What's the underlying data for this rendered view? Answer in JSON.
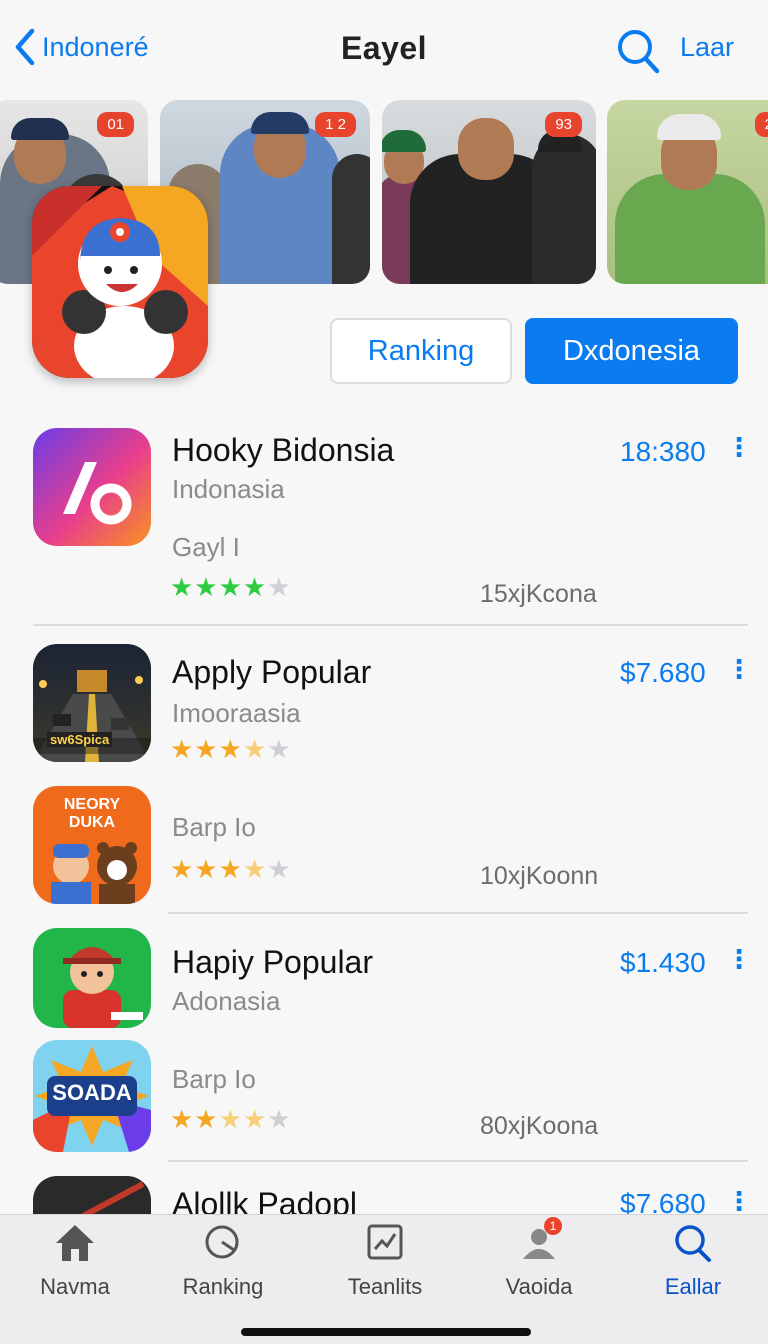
{
  "nav": {
    "back_label": "Indoneré",
    "title": "Eayel",
    "right_label": "Laar"
  },
  "banner": {
    "badges": [
      "01",
      "1 2",
      "93",
      "2"
    ]
  },
  "actions": {
    "ranking_label": "Ranking",
    "primary_label": "Dxdonesia"
  },
  "list": [
    {
      "name": "Hooky Bidonsia",
      "subtitle": "Indonasia",
      "price": "18:380",
      "category": "Gayl I",
      "count": "15xjKcona",
      "rating": 4.0
    },
    {
      "name": "Apply Popular",
      "subtitle": "Imooraasia",
      "price": "$7.680",
      "icon_text": "sw6Spica",
      "rating": 3.5
    },
    {
      "name": "",
      "icon_text": "NEORY DUKA",
      "category": "Barp Io",
      "count": "10xjKoonn",
      "rating": 3.5
    },
    {
      "name": "Hapiy Popular",
      "subtitle": "Adonasia",
      "price": "$1.430",
      "rating": 0
    },
    {
      "name": "",
      "icon_text": "SOADA",
      "category": "Barp Io",
      "count": "80xjKoona",
      "rating": 3.0
    },
    {
      "name": "Alollk Padopl",
      "price": "$7.680"
    }
  ],
  "tabs": [
    {
      "label": "Navma",
      "icon": "home-icon"
    },
    {
      "label": "Ranking",
      "icon": "ranking-icon"
    },
    {
      "label": "Teanlits",
      "icon": "chart-icon"
    },
    {
      "label": "Vaoida",
      "icon": "person-icon",
      "badge": "1"
    },
    {
      "label": "Eallar",
      "icon": "search-icon"
    }
  ],
  "colors": {
    "accent": "#0a7cf0",
    "badge": "#e8442d",
    "star_green": "#2ecc40",
    "star_orange": "#f5a623"
  }
}
